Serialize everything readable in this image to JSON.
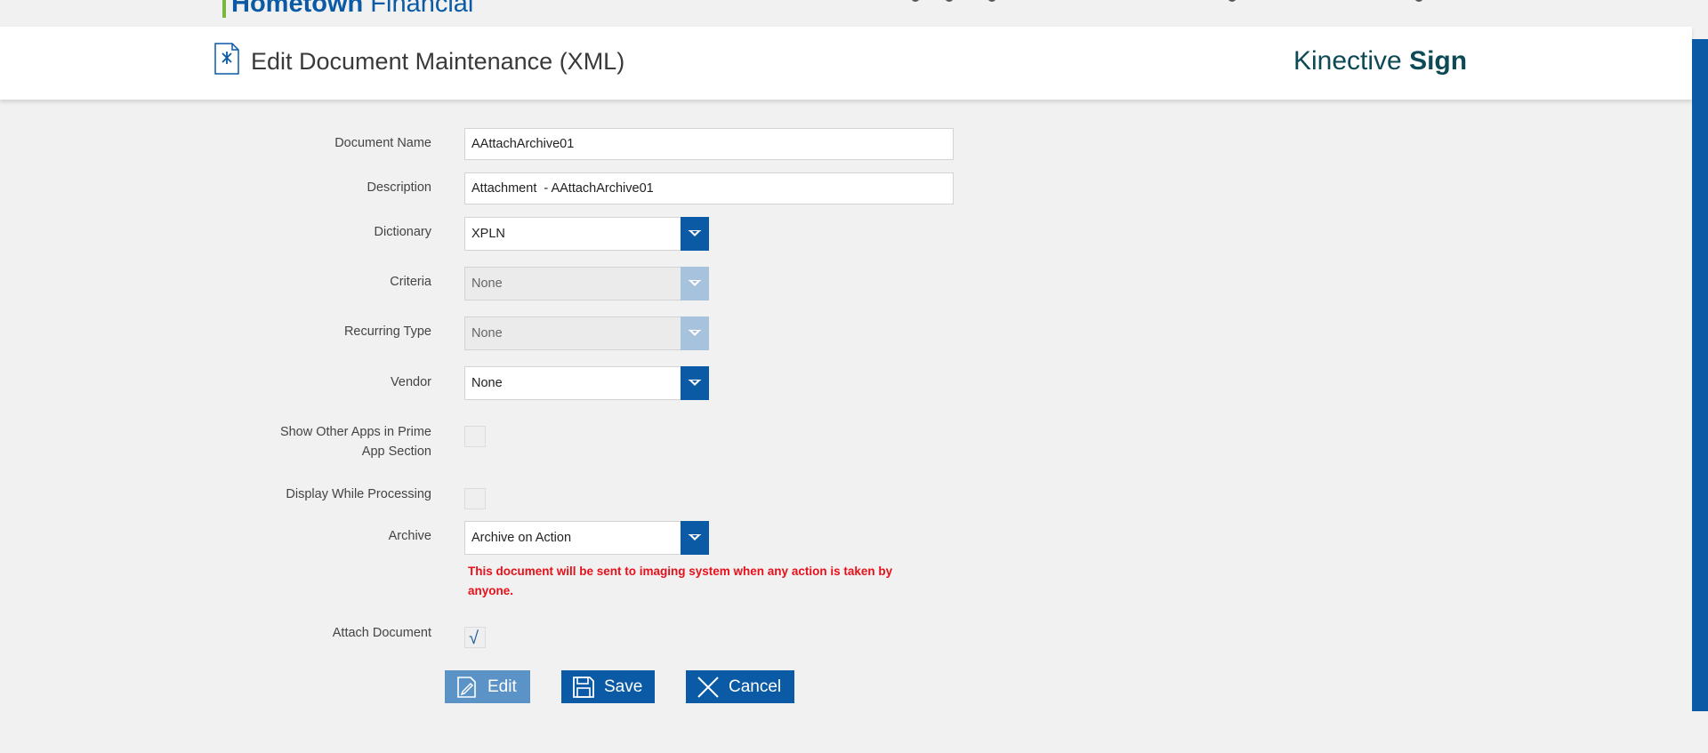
{
  "topbar": {
    "logo_bold": "Hometown",
    "logo_light": "Financial"
  },
  "header": {
    "title": "Edit Document Maintenance (XML)",
    "brand_light": "Kinective",
    "brand_bold": "Sign"
  },
  "form": {
    "document_name": {
      "label": "Document Name",
      "value": "AAttachArchive01"
    },
    "description": {
      "label": "Description",
      "value": "Attachment  - AAttachArchive01"
    },
    "dictionary": {
      "label": "Dictionary",
      "value": "XPLN"
    },
    "criteria": {
      "label": "Criteria",
      "value": "None"
    },
    "recurring_type": {
      "label": "Recurring Type",
      "value": "None"
    },
    "vendor": {
      "label": "Vendor",
      "value": "None"
    },
    "show_other_apps": {
      "label_line1": "Show Other Apps in Prime",
      "label_line2": "App Section",
      "checked": false
    },
    "display_while_processing": {
      "label": "Display While Processing",
      "checked": false
    },
    "archive": {
      "label": "Archive",
      "value": "Archive on Action",
      "warning_line1": "This document will be sent to imaging system when any action is taken by",
      "warning_line2": "anyone."
    },
    "attach_document": {
      "label": "Attach Document",
      "checked": true,
      "check_glyph": "√"
    }
  },
  "buttons": {
    "edit": "Edit",
    "save": "Save",
    "cancel": "Cancel"
  },
  "icons": {
    "doc": "document-icon",
    "edit": "pencil-icon",
    "save": "floppy-icon",
    "cancel": "close-icon",
    "dropdown": "chevron-down-icon"
  },
  "colors": {
    "primary": "#0a5aa5",
    "disabled_primary": "#5b93c6",
    "warning": "#e8101a",
    "logo_green": "#7ab83d",
    "brand": "#0e4a55"
  }
}
